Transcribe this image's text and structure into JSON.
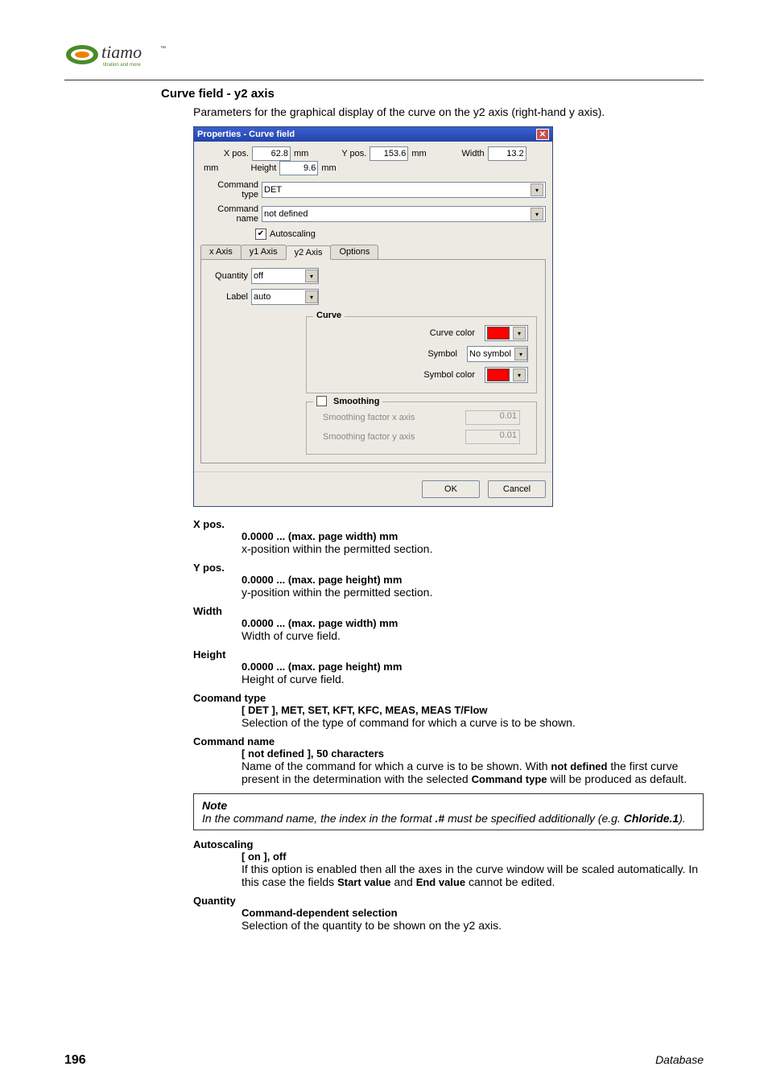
{
  "header": {
    "section_title": "Curve field - y2 axis",
    "intro": "Parameters for the graphical display of the curve on the y2 axis (right-hand y axis)."
  },
  "dialog": {
    "title": "Properties - Curve field",
    "xpos_label": "X pos.",
    "xpos_value": "62.8",
    "ypos_label": "Y pos.",
    "ypos_value": "153.6",
    "width_label": "Width",
    "width_value": "13.2",
    "height_label": "Height",
    "height_value": "9.6",
    "unit": "mm",
    "command_type_label": "Command type",
    "command_type_value": "DET",
    "command_name_label": "Command name",
    "command_name_value": "not defined",
    "autoscaling_label": "Autoscaling",
    "autoscaling_checked": "✔",
    "tabs": {
      "xaxis": "x Axis",
      "y1axis": "y1 Axis",
      "y2axis": "y2 Axis",
      "options": "Options"
    },
    "quantity_label": "Quantity",
    "quantity_value": "off",
    "label_label": "Label",
    "label_value": "auto",
    "curve_legend": "Curve",
    "curve_color_label": "Curve color",
    "symbol_label": "Symbol",
    "symbol_value": "No symbol",
    "symbol_color_label": "Symbol color",
    "smoothing_legend": "Smoothing",
    "smooth_x_label": "Smoothing factor x axis",
    "smooth_x_value": "0.01",
    "smooth_y_label": "Smoothing factor y axis",
    "smooth_y_value": "0.01",
    "ok": "OK",
    "cancel": "Cancel"
  },
  "defs": {
    "xpos": {
      "term": "X pos.",
      "range": "0.0000 ... (max. page width) mm",
      "desc": "x-position within the permitted section."
    },
    "ypos": {
      "term": "Y pos.",
      "range": "0.0000 ... (max. page height) mm",
      "desc": "y-position within the permitted section."
    },
    "width": {
      "term": "Width",
      "range": "0.0000 ... (max. page width) mm",
      "desc": "Width of curve field."
    },
    "height": {
      "term": "Height",
      "range": "0.0000 ... (max. page height) mm",
      "desc": "Height of curve field."
    },
    "cmdtype": {
      "term": "Coomand type",
      "range": "[ DET ], MET, SET, KFT, KFC, MEAS, MEAS T/Flow",
      "desc": "Selection of the type of command for which a curve is to be shown."
    },
    "cmdname": {
      "term": "Command name",
      "range": "[ not defined ], 50 characters",
      "desc_pre": "Name of the command for which a curve is to be shown. With ",
      "desc_bold1": "not defined",
      "desc_mid": " the first curve present in the determination with the selected ",
      "desc_bold2": "Command type",
      "desc_post": " will be produced as default."
    },
    "autoscaling": {
      "term": "Autoscaling",
      "range": "[ on ], off",
      "desc_pre": "If this option is enabled then all the axes in the curve window will be scaled automatically. In this case the fields ",
      "desc_b1": "Start value",
      "desc_mid": " and ",
      "desc_b2": "End value",
      "desc_post": " cannot be edited."
    },
    "quantity": {
      "term": "Quantity",
      "range": "Command-dependent selection",
      "desc": "Selection of the quantity to be shown on the y2 axis."
    }
  },
  "note": {
    "title": "Note",
    "text_pre": "In the command name, the index in the format ",
    "format": ".#",
    "text_mid": " must be specified additionally (e.g. ",
    "example": "Chloride.1",
    "text_post": ")."
  },
  "footer": {
    "page": "196",
    "source": "Database"
  }
}
